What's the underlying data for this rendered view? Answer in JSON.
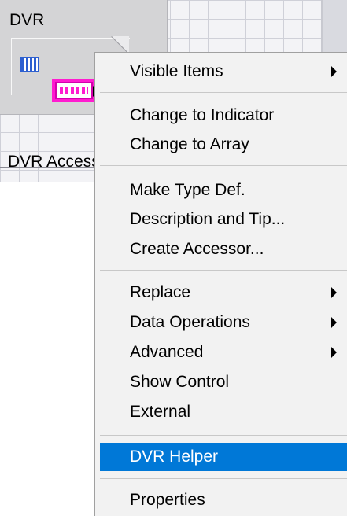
{
  "control": {
    "label": "DVR",
    "accessor_label": "DVR Access"
  },
  "menu": {
    "items": [
      {
        "label": "Visible Items",
        "submenu": true
      },
      {
        "label": "Change to Indicator",
        "submenu": false
      },
      {
        "label": "Change to Array",
        "submenu": false
      },
      {
        "label": "Make Type Def.",
        "submenu": false
      },
      {
        "label": "Description and Tip...",
        "submenu": false
      },
      {
        "label": "Create Accessor...",
        "submenu": false
      },
      {
        "label": "Replace",
        "submenu": true
      },
      {
        "label": "Data Operations",
        "submenu": true
      },
      {
        "label": "Advanced",
        "submenu": true
      },
      {
        "label": "Show Control",
        "submenu": false
      },
      {
        "label": "External",
        "submenu": false
      },
      {
        "label": "DVR Helper",
        "submenu": false,
        "selected": true
      },
      {
        "label": "Properties",
        "submenu": false
      }
    ]
  },
  "colors": {
    "highlight": "#0078d7",
    "dvr_terminal": "#ff1bd0",
    "cluster_icon": "#2d5fd0"
  }
}
